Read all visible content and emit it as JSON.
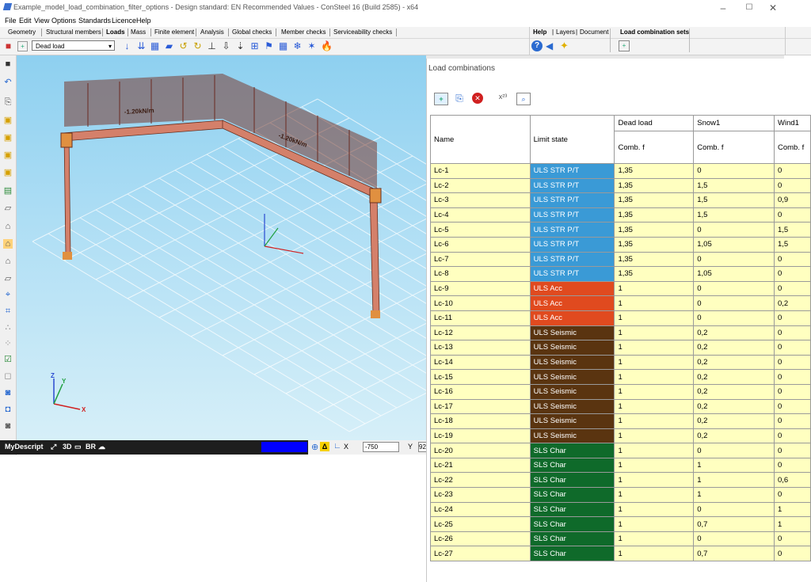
{
  "window": {
    "title": "Example_model_load_combination_filter_options - Design standard: EN Recommended Values - ConSteel 16 (Build 2585) - x64",
    "controls": [
      "–",
      "☐",
      "✕"
    ]
  },
  "menu": [
    "File",
    "Edit",
    "View",
    "Options",
    "Standards",
    "Licence",
    "Help"
  ],
  "tabs": [
    "Geometry",
    "Structural members",
    "Loads",
    "Mass",
    "Finite element",
    "Analysis",
    "Global checks",
    "Member checks",
    "Serviceability checks"
  ],
  "right_tabs": [
    "Help",
    "Layers",
    "Document"
  ],
  "load_comb_sets_label": "Load combination sets",
  "load_case": {
    "selected": "Dead load"
  },
  "viewport": {
    "load_label_1": "-1.20kN/m",
    "load_label_2": "-1.20kN/m",
    "axis_labels": {
      "x": "X",
      "y": "Y",
      "z": "Z"
    }
  },
  "statusbar": {
    "description": "MyDescript",
    "view_3d": "3D",
    "br": "BR",
    "x_label": "X",
    "x_value": "-750",
    "y_label": "Y",
    "y_value": "92"
  },
  "load_combinations": {
    "title": "Load combinations",
    "headers": {
      "name": "Name",
      "limit_state": "Limit state",
      "cases": [
        "Dead load",
        "Snow1",
        "Wind1"
      ],
      "factor": "Comb. f"
    },
    "limit_state_colors": {
      "ULS STR P/T": "#3a9ad6",
      "ULS Acc": "#e04a1f",
      "ULS Seismic": "#5a3410",
      "SLS Char": "#0f6a2a"
    },
    "rows": [
      {
        "name": "Lc-1",
        "ls": "ULS STR P/T",
        "v": [
          "1,35",
          "0",
          "0"
        ]
      },
      {
        "name": "Lc-2",
        "ls": "ULS STR P/T",
        "v": [
          "1,35",
          "1,5",
          "0"
        ]
      },
      {
        "name": "Lc-3",
        "ls": "ULS STR P/T",
        "v": [
          "1,35",
          "1,5",
          "0,9"
        ]
      },
      {
        "name": "Lc-4",
        "ls": "ULS STR P/T",
        "v": [
          "1,35",
          "1,5",
          "0"
        ]
      },
      {
        "name": "Lc-5",
        "ls": "ULS STR P/T",
        "v": [
          "1,35",
          "0",
          "1,5"
        ]
      },
      {
        "name": "Lc-6",
        "ls": "ULS STR P/T",
        "v": [
          "1,35",
          "1,05",
          "1,5"
        ]
      },
      {
        "name": "Lc-7",
        "ls": "ULS STR P/T",
        "v": [
          "1,35",
          "0",
          "0"
        ]
      },
      {
        "name": "Lc-8",
        "ls": "ULS STR P/T",
        "v": [
          "1,35",
          "1,05",
          "0"
        ]
      },
      {
        "name": "Lc-9",
        "ls": "ULS Acc",
        "v": [
          "1",
          "0",
          "0"
        ]
      },
      {
        "name": "Lc-10",
        "ls": "ULS Acc",
        "v": [
          "1",
          "0",
          "0,2"
        ]
      },
      {
        "name": "Lc-11",
        "ls": "ULS Acc",
        "v": [
          "1",
          "0",
          "0"
        ]
      },
      {
        "name": "Lc-12",
        "ls": "ULS Seismic",
        "v": [
          "1",
          "0,2",
          "0"
        ]
      },
      {
        "name": "Lc-13",
        "ls": "ULS Seismic",
        "v": [
          "1",
          "0,2",
          "0"
        ]
      },
      {
        "name": "Lc-14",
        "ls": "ULS Seismic",
        "v": [
          "1",
          "0,2",
          "0"
        ]
      },
      {
        "name": "Lc-15",
        "ls": "ULS Seismic",
        "v": [
          "1",
          "0,2",
          "0"
        ]
      },
      {
        "name": "Lc-16",
        "ls": "ULS Seismic",
        "v": [
          "1",
          "0,2",
          "0"
        ]
      },
      {
        "name": "Lc-17",
        "ls": "ULS Seismic",
        "v": [
          "1",
          "0,2",
          "0"
        ]
      },
      {
        "name": "Lc-18",
        "ls": "ULS Seismic",
        "v": [
          "1",
          "0,2",
          "0"
        ]
      },
      {
        "name": "Lc-19",
        "ls": "ULS Seismic",
        "v": [
          "1",
          "0,2",
          "0"
        ]
      },
      {
        "name": "Lc-20",
        "ls": "SLS Char",
        "v": [
          "1",
          "0",
          "0"
        ]
      },
      {
        "name": "Lc-21",
        "ls": "SLS Char",
        "v": [
          "1",
          "1",
          "0"
        ]
      },
      {
        "name": "Lc-22",
        "ls": "SLS Char",
        "v": [
          "1",
          "1",
          "0,6"
        ]
      },
      {
        "name": "Lc-23",
        "ls": "SLS Char",
        "v": [
          "1",
          "1",
          "0"
        ]
      },
      {
        "name": "Lc-24",
        "ls": "SLS Char",
        "v": [
          "1",
          "0",
          "1"
        ]
      },
      {
        "name": "Lc-25",
        "ls": "SLS Char",
        "v": [
          "1",
          "0,7",
          "1"
        ]
      },
      {
        "name": "Lc-26",
        "ls": "SLS Char",
        "v": [
          "1",
          "0",
          "0"
        ]
      },
      {
        "name": "Lc-27",
        "ls": "SLS Char",
        "v": [
          "1",
          "0,7",
          "0"
        ]
      }
    ]
  }
}
